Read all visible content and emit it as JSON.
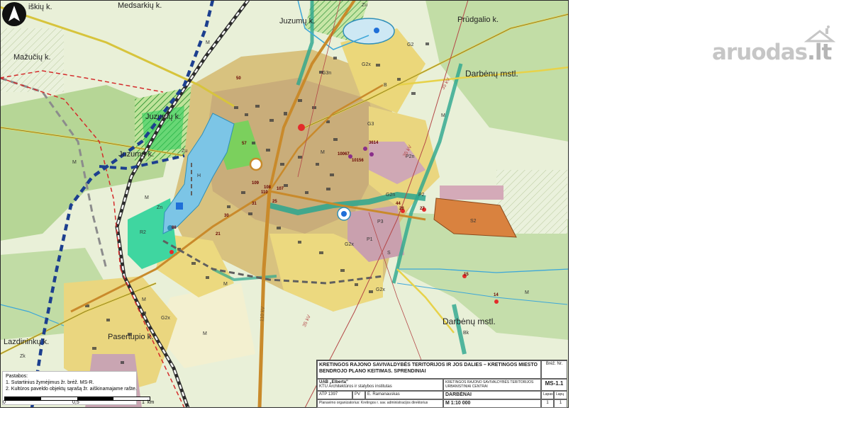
{
  "map": {
    "places": {
      "medsarkiu": "Medsarkių k.",
      "iskiu": "iškių k.",
      "juzumu_top": "Juzumų k.",
      "prudgalio": "Prūdgalio k.",
      "maziuciu": "Mažučių k.",
      "darbenu_mstl_top": "Darbėnų mstl.",
      "juzumu_mid": "Juzumų k.",
      "juzumu_low": "Juzumų k.",
      "lazdininku": "Lazdininkų k.",
      "pasertupio": "Pasertupio k.",
      "darbenu_mstl_bottom": "Darbėnų mstl."
    },
    "zone_codes": [
      "M",
      "Zu",
      "G2",
      "G2x",
      "G3n",
      "G3",
      "B",
      "P2n",
      "P3",
      "S2",
      "R2",
      "Bk",
      "Zn",
      "Zk",
      "H",
      "P2",
      "G2n",
      "S",
      "Zu",
      "M",
      "M",
      "M",
      "M",
      "M",
      "M",
      "M",
      "G2x",
      "G2x",
      "G2x",
      "P1",
      "M"
    ],
    "object_numbers": [
      "50",
      "57",
      "3614",
      "10067",
      "10156",
      "109",
      "108",
      "110",
      "107",
      "31",
      "30",
      "21",
      "27",
      "28",
      "86",
      "15",
      "14",
      "44",
      "25"
    ],
    "line_labels": [
      "35 kV",
      "35 kV",
      "35 kV",
      "110 kV"
    ]
  },
  "notes": {
    "title": "Pastabos:",
    "line1": "1. Sutartinius žymėjimus žr. brėž. MS-R.",
    "line2": "2. Kultūros paveldo objektų sąrašą žr. aiškinamajame rašte."
  },
  "scale": {
    "zero": "0",
    "half": "0,5",
    "one": "1",
    "unit": "km"
  },
  "title_block": {
    "project_title": "KRETINGOS RAJONO SAVIVALDYBĖS TERITORIJOS IR JOS DALIES – KRETINGOS MIESTO BENDROJO PLANO KEITIMAS. SPRENDINIAI",
    "drawing_no_label": "Brėž. Nr.",
    "drawing_no": "MS-1.1",
    "company_name": "UAB „Elberta\"",
    "company_sub": "KTU Architektūros ir statybos institutas",
    "client": "KRETINGOS RAJONO SAVIVALDYBĖS TERITORIJOS URBANISTINIAI CENTRAI",
    "atp": "ATP 1397",
    "pv": "PV",
    "author": "E. Ramanauskas",
    "place": "DARBĖNAI",
    "scale": "M 1:10 000",
    "organizer": "Planavimo organizatorius: Kretingos r. sav. administracijos direktorius",
    "sheet_label": "Lapas",
    "sheets_label": "Lapų",
    "sheet": "1",
    "sheets": "1"
  },
  "watermark": {
    "brand": "aruodas",
    "tld": ".lt"
  },
  "colors": {
    "residential": "#e9d57a",
    "residential_dense": "#c9b37a",
    "industrial": "#c9a5b2",
    "agri": "#e7efd9",
    "forest": "#8fbf6f",
    "water": "#7cc5e6",
    "industrial_orange": "#d9823f",
    "rail": "#5a5a5a",
    "road_main": "#c98a2b"
  }
}
